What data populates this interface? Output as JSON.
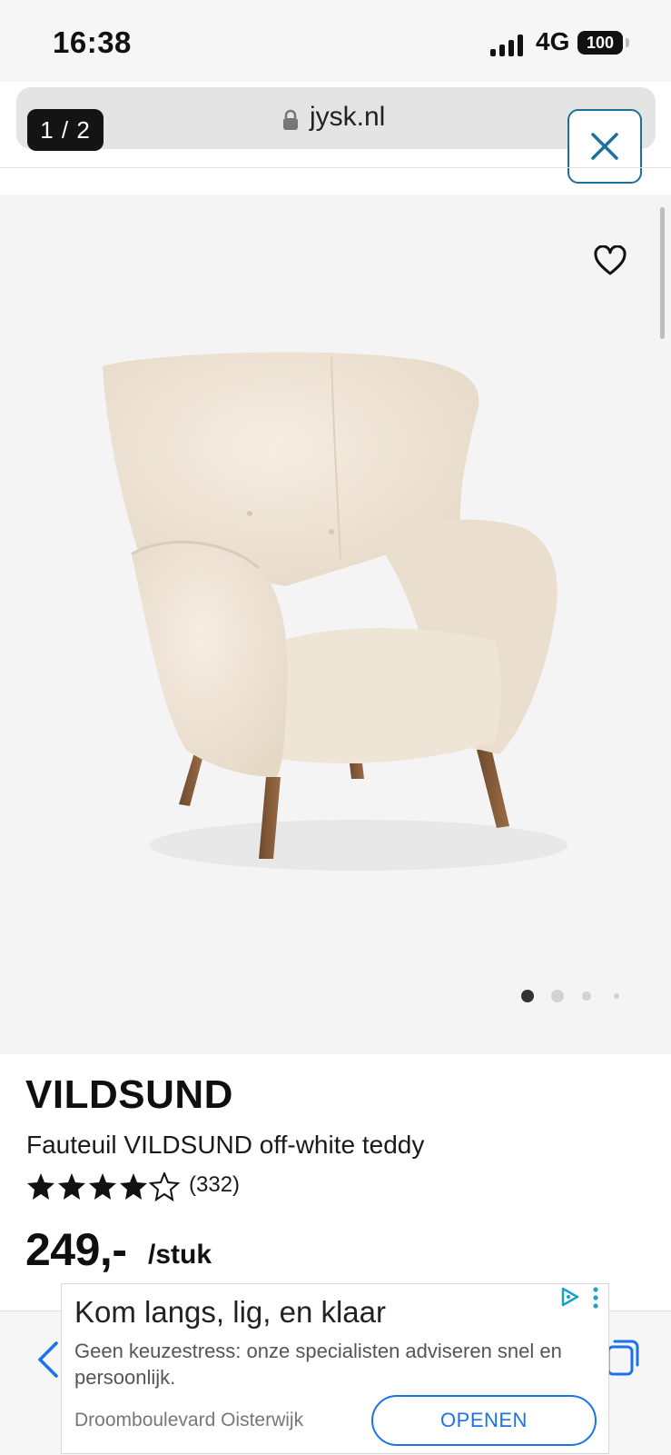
{
  "status_bar": {
    "time": "16:38",
    "network": "4G",
    "battery": "100"
  },
  "browser": {
    "url": "jysk.nl",
    "page_counter": "1 / 2"
  },
  "product": {
    "brand": "VILDSUND",
    "name": "Fauteuil VILDSUND off-white teddy",
    "rating": 4.5,
    "reviews": "(332)",
    "price": "249,-",
    "unit": "/stuk",
    "image_count": 4,
    "active_image": 1
  },
  "ad": {
    "title": "Kom langs, lig, en klaar",
    "body": "Geen keuzestress: onze specialisten adviseren snel en persoonlijk.",
    "source": "Droomboulevard Oisterwijk",
    "cta": "OPENEN"
  },
  "colors": {
    "accent_blue": "#1f6f9b",
    "ad_blue": "#1a73e8"
  },
  "icons": [
    "lock-icon",
    "close-icon",
    "heart-icon",
    "star-icon",
    "back-icon",
    "tabs-icon",
    "adchoices-icon",
    "more-icon"
  ]
}
